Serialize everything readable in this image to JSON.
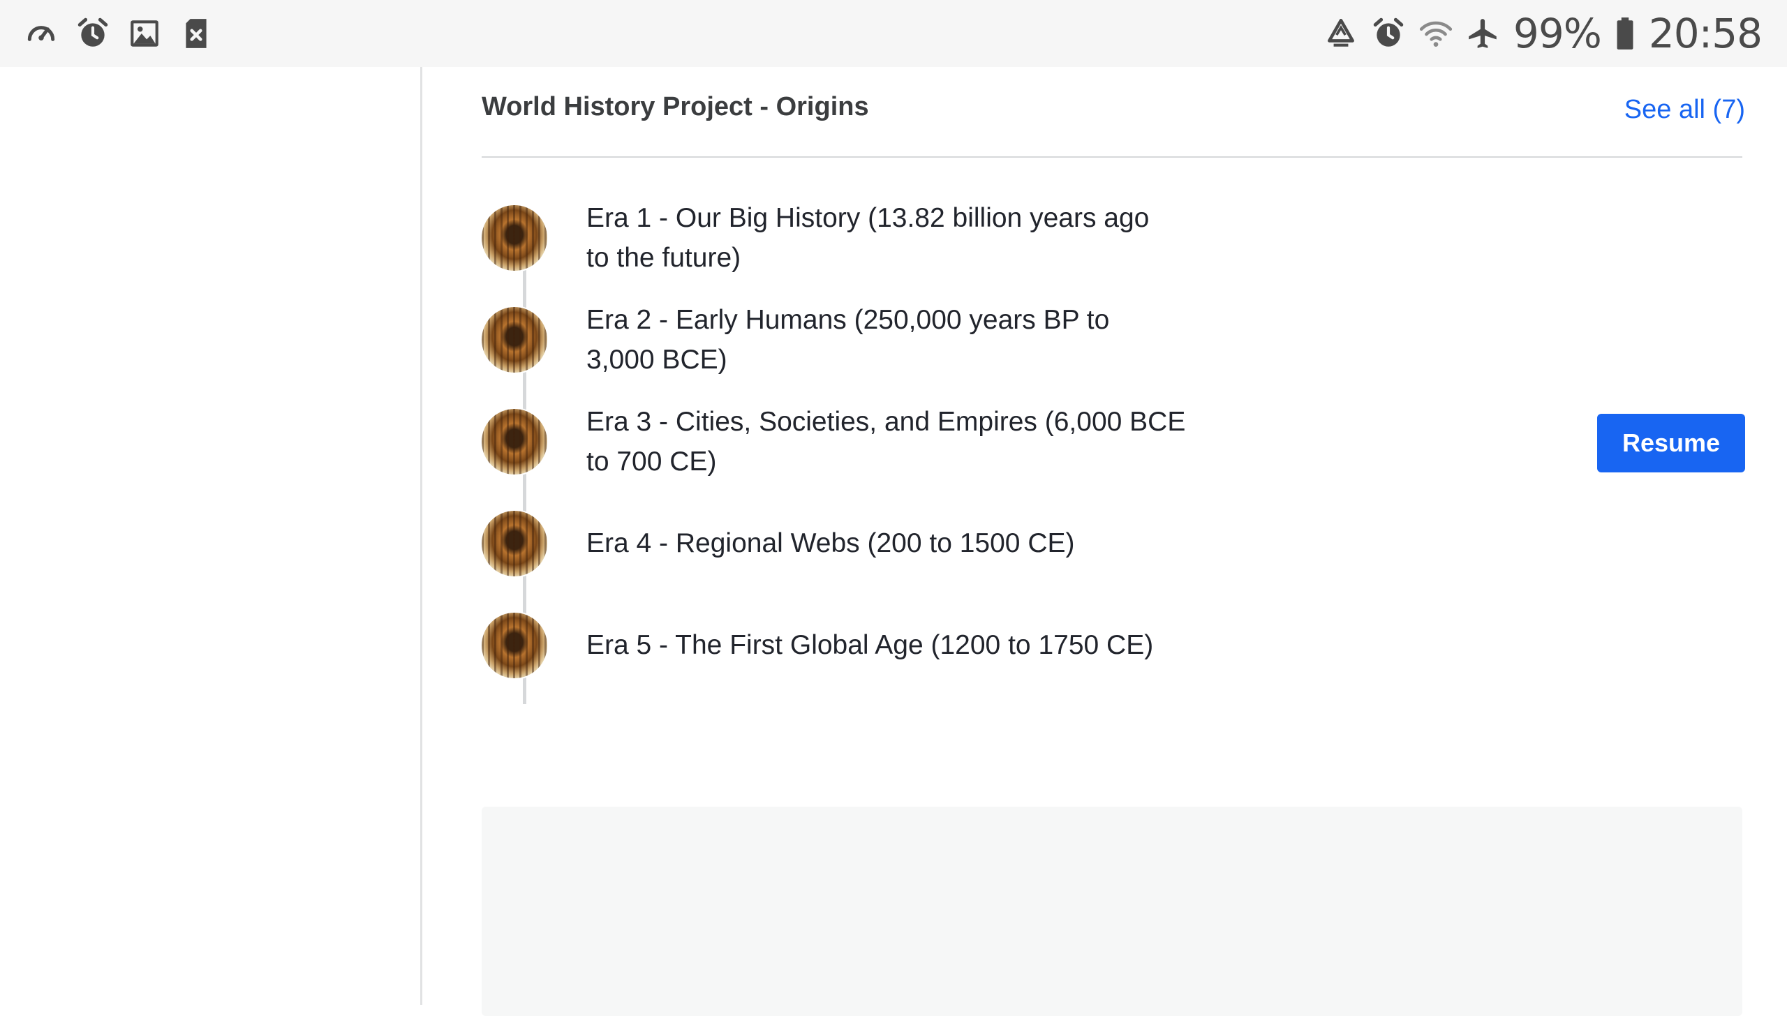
{
  "status_bar": {
    "left_icons": [
      "speedometer-icon",
      "alarm-icon",
      "image-icon",
      "sd-card-error-icon"
    ],
    "right_icons": [
      "recycle-icon",
      "alarm-icon",
      "wifi-icon",
      "airplane-icon"
    ],
    "battery_text": "99%",
    "time": "20:58"
  },
  "section": {
    "title": "World History Project - Origins",
    "see_all": "See all (7)"
  },
  "items": [
    {
      "line1": "Era 1 - Our Big History (13.82 billion years ago",
      "line2": "to the future)"
    },
    {
      "line1": "Era 2 - Early Humans (250,000 years BP to",
      "line2": "3,000 BCE)"
    },
    {
      "line1": "Era 3 - Cities, Societies, and Empires (6,000 BCE",
      "line2": "to 700 CE)"
    },
    {
      "line1": "Era 4 - Regional Webs (200 to 1500 CE)",
      "line2": ""
    },
    {
      "line1": "Era 5 - The First Global Age (1200 to 1750 CE)",
      "line2": ""
    }
  ],
  "resume_label": "Resume",
  "colors": {
    "accent": "#1865f2",
    "text": "#21242c",
    "divider": "#d6d8da"
  }
}
